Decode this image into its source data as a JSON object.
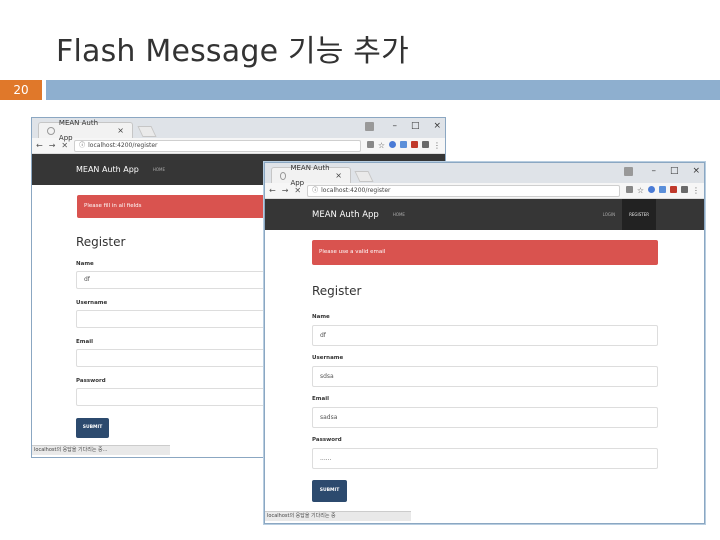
{
  "slide": {
    "title": "Flash Message 기능 추가",
    "number": "20",
    "accent_color": "#e0782a",
    "bar_color": "#8eafcf"
  },
  "back_window": {
    "tab_title": "MEAN Auth App",
    "tab_close": "×",
    "window_controls": [
      "–",
      "□",
      "×"
    ],
    "url": "localhost:4200/register",
    "nav": {
      "brand": "MEAN Auth App",
      "home": "HOME"
    },
    "alert": "Please fill in all fields",
    "heading": "Register",
    "fields": [
      {
        "label": "Name",
        "value": "df"
      },
      {
        "label": "Username",
        "value": ""
      },
      {
        "label": "Email",
        "value": ""
      },
      {
        "label": "Password",
        "value": ""
      }
    ],
    "submit": "SUBMIT",
    "status": "localhost의 응답을 기다리는 중..."
  },
  "front_window": {
    "tab_title": "MEAN Auth App",
    "tab_close": "×",
    "window_controls": [
      "–",
      "□",
      "×"
    ],
    "url": "localhost:4200/register",
    "nav": {
      "brand": "MEAN Auth App",
      "home": "HOME",
      "login": "LOGIN",
      "register": "REGISTER"
    },
    "alert": "Please use a valid email",
    "heading": "Register",
    "fields": [
      {
        "label": "Name",
        "value": "df"
      },
      {
        "label": "Username",
        "value": "sdsa"
      },
      {
        "label": "Email",
        "value": "sadsa"
      },
      {
        "label": "Password",
        "value": "......"
      }
    ],
    "submit": "SUBMIT",
    "status": "localhost의 응답을 기다리는 중"
  },
  "colors": {
    "navbar": "#363636",
    "alert": "#d9534f",
    "submit": "#2c4a6e"
  },
  "icons": [
    "back-arrow-icon",
    "forward-arrow-icon",
    "reload-icon",
    "page-info-icon",
    "translate-icon",
    "star-icon",
    "menu-icon"
  ]
}
